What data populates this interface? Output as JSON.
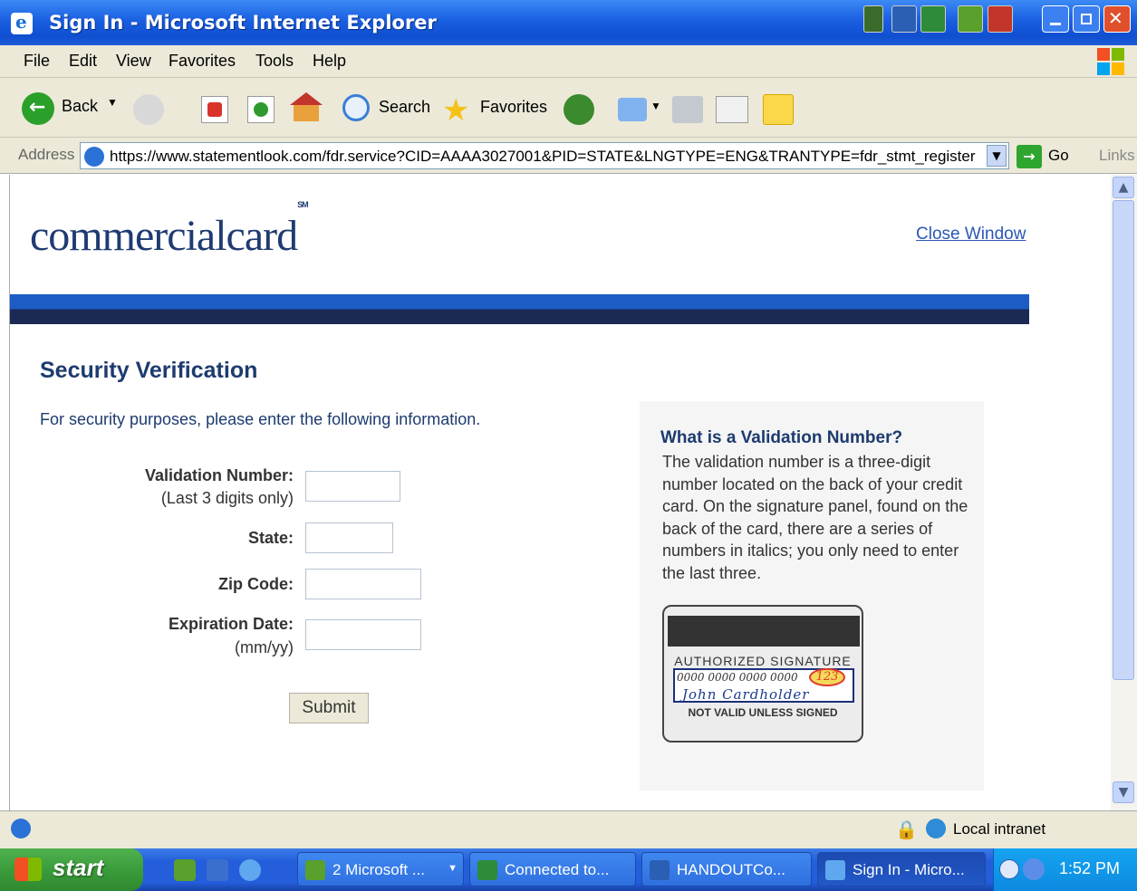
{
  "window": {
    "title": "Sign In - Microsoft Internet Explorer"
  },
  "menu": [
    "File",
    "Edit",
    "View",
    "Favorites",
    "Tools",
    "Help"
  ],
  "toolbar": {
    "back": "Back",
    "search": "Search",
    "favorites": "Favorites"
  },
  "address": {
    "label": "Address",
    "url": "https://www.statementlook.com/fdr.service?CID=AAAA3027001&PID=STATE&LNGTYPE=ENG&TRANTYPE=fdr_stmt_register",
    "go": "Go",
    "links": "Links"
  },
  "page": {
    "logo": "commercialcard",
    "logo_mark": "SM",
    "close_window": "Close Window",
    "heading": "Security Verification",
    "intro": "For security purposes, please enter the following information.",
    "fields": {
      "validation_label": "Validation Number:",
      "validation_sub": "(Last 3 digits only)",
      "state_label": "State:",
      "zip_label": "Zip Code:",
      "expiration_label": "Expiration Date:",
      "expiration_sub": "(mm/yy)"
    },
    "submit": "Submit",
    "help": {
      "title": "What is a Validation Number?",
      "text": "The validation number is a three-digit number located on the back of your credit card. On the signature panel, found on the back of the card, there are a series of numbers in italics; you only need to enter the last three."
    },
    "card": {
      "authorized": "AUTHORIZED SIGNATURE",
      "numbers": "0000 0000 0000 0000",
      "cvv": "123",
      "name": "John Cardholder",
      "not_valid": "NOT VALID UNLESS SIGNED"
    }
  },
  "status": {
    "zone": "Local intranet"
  },
  "taskbar": {
    "start": "start",
    "tasks": [
      "2 Microsoft ...",
      "Connected to...",
      "HANDOUTCo...",
      "Sign In - Micro..."
    ],
    "clock": "1:52 PM"
  },
  "colors": {
    "brand_blue": "#1d3b6e",
    "band_top": "#1d5cc4",
    "band_bottom": "#1a2a55",
    "link": "#2a57b5"
  }
}
